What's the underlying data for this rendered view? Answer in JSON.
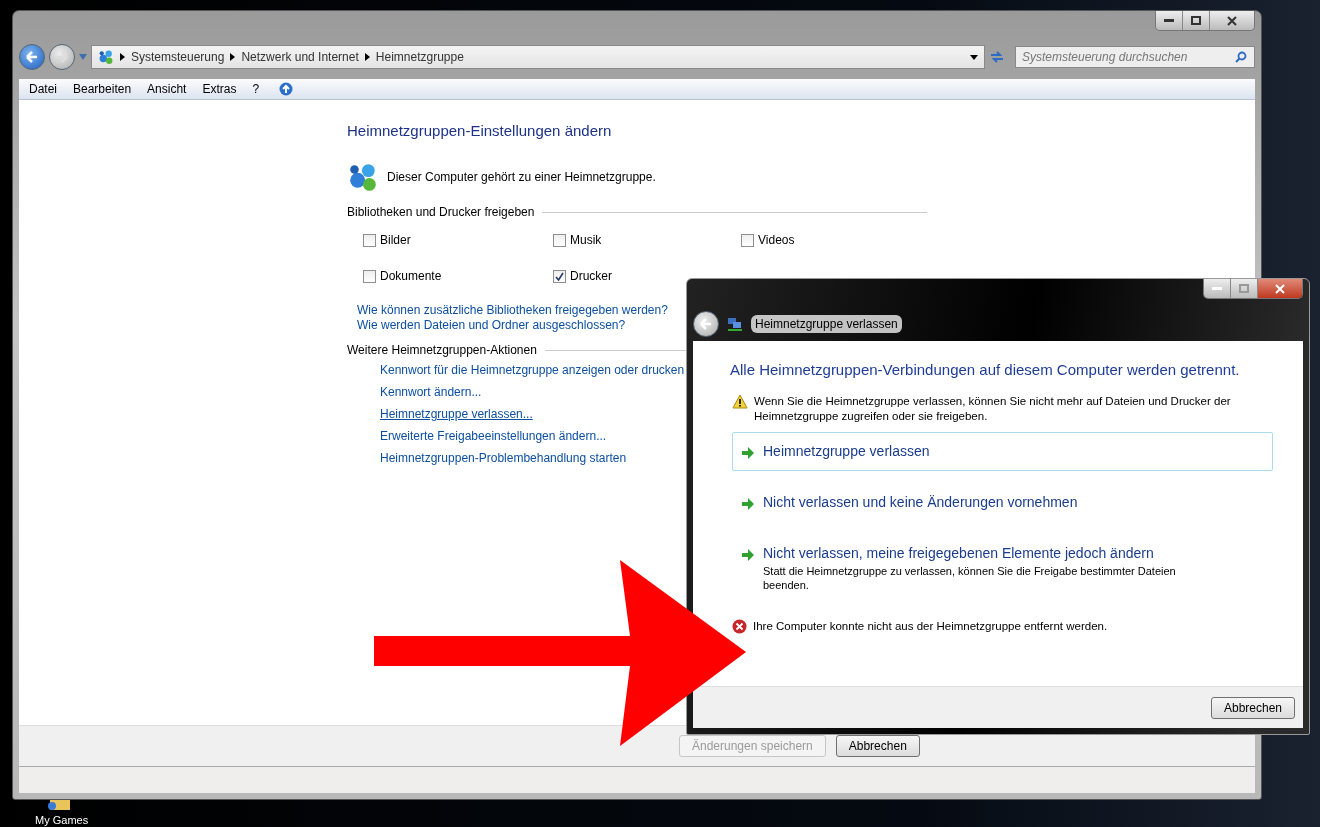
{
  "explorer": {
    "breadcrumb": [
      "Systemsteuerung",
      "Netzwerk und Internet",
      "Heimnetzgruppe"
    ],
    "search": {
      "placeholder": "Systemsteuerung durchsuchen"
    },
    "menu": [
      "Datei",
      "Bearbeiten",
      "Ansicht",
      "Extras",
      "?"
    ]
  },
  "page": {
    "title": "Heimnetzgruppen-Einstellungen ändern",
    "status": "Dieser Computer gehört zu einer Heimnetzgruppe.",
    "share_heading": "Bibliotheken und Drucker freigeben",
    "share_items": [
      {
        "label": "Bilder",
        "checked": false
      },
      {
        "label": "Musik",
        "checked": false
      },
      {
        "label": "Videos",
        "checked": false
      },
      {
        "label": "Dokumente",
        "checked": false
      },
      {
        "label": "Drucker",
        "checked": true
      }
    ],
    "links": [
      "Wie können zusätzliche Bibliotheken freigegeben werden?",
      "Wie werden Dateien und Ordner ausgeschlossen?"
    ],
    "actions_heading": "Weitere Heimnetzgruppen-Aktionen",
    "actions": [
      {
        "label": "Kennwort für die Heimnetzgruppe anzeigen oder drucken",
        "underlined": false
      },
      {
        "label": "Kennwort ändern...",
        "underlined": false
      },
      {
        "label": "Heimnetzgruppe verlassen...",
        "underlined": true
      },
      {
        "label": "Erweiterte Freigabeeinstellungen ändern...",
        "underlined": false
      },
      {
        "label": "Heimnetzgruppen-Problembehandlung starten",
        "underlined": false
      }
    ]
  },
  "footer": {
    "buttons": [
      {
        "label": "Änderungen speichern",
        "disabled": true
      },
      {
        "label": "Abbrechen",
        "disabled": false
      }
    ]
  },
  "dialog": {
    "title": "Heimnetzgruppe verlassen",
    "heading": "Alle Heimnetzgruppen-Verbindungen auf diesem Computer werden getrennt.",
    "warning": "Wenn Sie die Heimnetzgruppe verlassen, können Sie nicht mehr auf Dateien und Drucker der Heimnetzgruppe zugreifen oder sie freigeben.",
    "options": [
      {
        "label": "Heimnetzgruppe verlassen",
        "focused": true
      },
      {
        "label": "Nicht verlassen und keine Änderungen vornehmen",
        "focused": false
      },
      {
        "label": "Nicht verlassen, meine freigegebenen Elemente jedoch ändern",
        "description": "Statt die Heimnetzgruppe zu verlassen, können Sie die Freigabe bestimmter Dateien beenden.",
        "focused": false
      }
    ],
    "error": "Ihre Computer konnte nicht aus der Heimnetzgruppe entfernt werden.",
    "buttons": [
      "Abbrechen"
    ]
  },
  "desktop": {
    "icons": [
      "My Games"
    ]
  }
}
